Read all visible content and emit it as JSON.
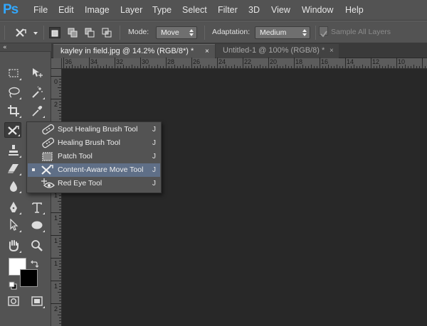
{
  "app": {
    "logo": "Ps"
  },
  "menu": [
    {
      "label": "File",
      "name": "menu-file"
    },
    {
      "label": "Edit",
      "name": "menu-edit"
    },
    {
      "label": "Image",
      "name": "menu-image"
    },
    {
      "label": "Layer",
      "name": "menu-layer"
    },
    {
      "label": "Type",
      "name": "menu-type"
    },
    {
      "label": "Select",
      "name": "menu-select"
    },
    {
      "label": "Filter",
      "name": "menu-filter"
    },
    {
      "label": "3D",
      "name": "menu-3d"
    },
    {
      "label": "View",
      "name": "menu-view"
    },
    {
      "label": "Window",
      "name": "menu-window"
    },
    {
      "label": "Help",
      "name": "menu-help"
    }
  ],
  "options": {
    "mode_label": "Mode:",
    "mode_value": "Move",
    "adaptation_label": "Adaptation:",
    "adaptation_value": "Medium",
    "sample_all_label": "Sample All Layers",
    "sample_all_checked": true,
    "selection_modes": [
      "new-selection",
      "add-to-selection",
      "subtract-from-selection",
      "intersect-with-selection"
    ],
    "active_selection_mode": "new-selection"
  },
  "tabs": [
    {
      "label": "kayley in field.jpg @ 14.2% (RGB/8*) *",
      "close": "×",
      "active": true
    },
    {
      "label": "Untitled-1 @ 100% (RGB/8) *",
      "close": "×",
      "active": false
    }
  ],
  "ruler": {
    "top_labels": [
      "36",
      "34",
      "32",
      "30",
      "28",
      "26",
      "24",
      "22",
      "20",
      "18",
      "16",
      "14",
      "12",
      "10",
      "8",
      "6",
      "4",
      "2"
    ],
    "left_labels": [
      "0",
      "2",
      "4",
      "6",
      "8",
      "1",
      "1",
      "1",
      "1",
      "1",
      "2"
    ]
  },
  "tools": {
    "selected": "content-aware-move",
    "list": [
      "rectangular-marquee",
      "move",
      "lasso",
      "magic-wand",
      "crop",
      "eyedropper",
      "content-aware-move",
      "brush",
      "clone-stamp",
      "history-brush",
      "eraser",
      "gradient",
      "blur",
      "dodge",
      "pen",
      "type",
      "path-selection",
      "ellipse",
      "hand",
      "zoom"
    ]
  },
  "colors": {
    "foreground": "#ffffff",
    "background": "#000000",
    "accent": "#31a8ff",
    "flyout_highlight": "#5f6f87"
  },
  "flyout": {
    "items": [
      {
        "label": "Spot Healing Brush Tool",
        "shortcut": "J",
        "icon": "spot-healing-brush-icon",
        "current": false
      },
      {
        "label": "Healing Brush Tool",
        "shortcut": "J",
        "icon": "healing-brush-icon",
        "current": false
      },
      {
        "label": "Patch Tool",
        "shortcut": "J",
        "icon": "patch-icon",
        "current": false
      },
      {
        "label": "Content-Aware Move Tool",
        "shortcut": "J",
        "icon": "content-aware-move-icon",
        "current": true
      },
      {
        "label": "Red Eye Tool",
        "shortcut": "J",
        "icon": "red-eye-icon",
        "current": false
      }
    ]
  }
}
